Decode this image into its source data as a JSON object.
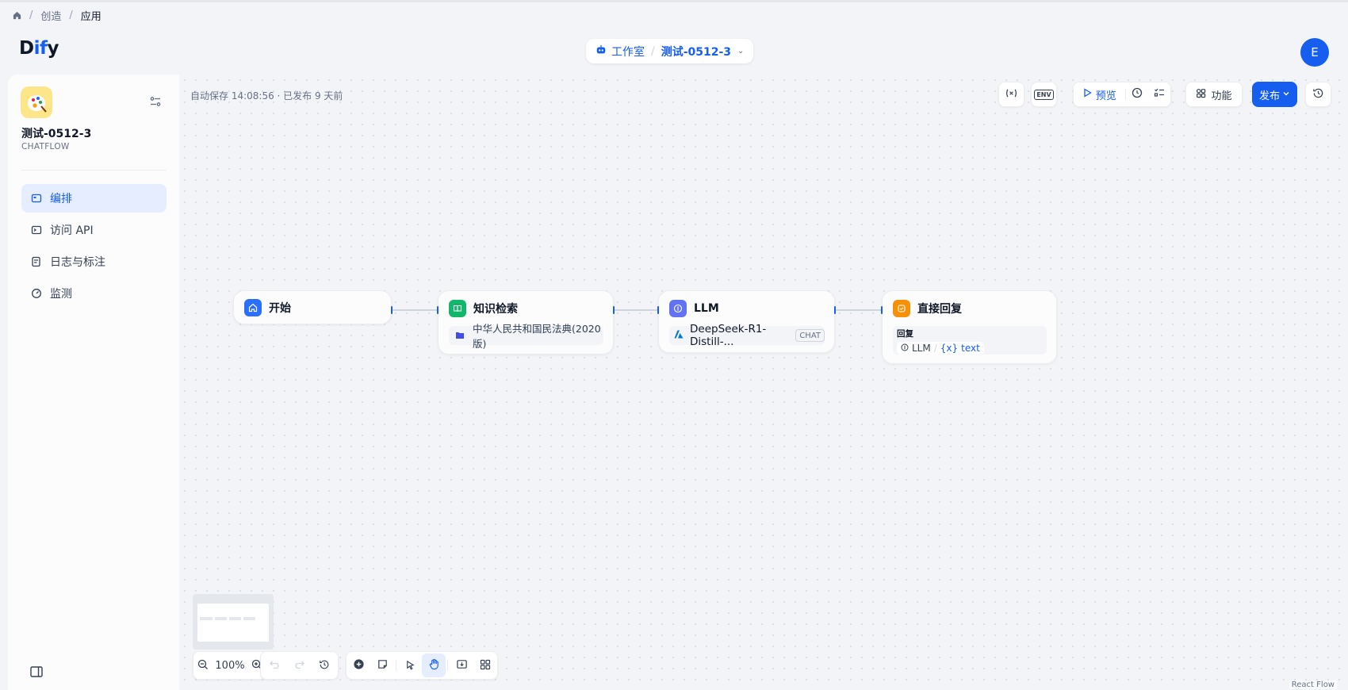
{
  "breadcrumb": {
    "items": [
      "创造",
      "应用"
    ]
  },
  "header": {
    "logo_prefix": "D",
    "logo_highlight": "if",
    "logo_suffix": "y",
    "workspace": "工作室",
    "app_name": "测试-0512-3",
    "avatar_initial": "E"
  },
  "sidebar": {
    "app_name": "测试-0512-3",
    "app_type": "CHATFLOW",
    "items": [
      {
        "label": "编排",
        "icon": "layout-icon",
        "active": true
      },
      {
        "label": "访问 API",
        "icon": "terminal-icon",
        "active": false
      },
      {
        "label": "日志与标注",
        "icon": "log-icon",
        "active": false
      },
      {
        "label": "监测",
        "icon": "monitor-icon",
        "active": false
      }
    ]
  },
  "canvas": {
    "autosave_text": "自动保存 14:08:56 · 已发布 9 天前",
    "toolbar": {
      "env_label": "ENV",
      "preview_label": "预览",
      "features_label": "功能",
      "publish_label": "发布"
    },
    "nodes": {
      "start": {
        "title": "开始"
      },
      "knowledge": {
        "title": "知识检索",
        "dataset": "中华人民共和国民法典(2020版)"
      },
      "llm": {
        "title": "LLM",
        "model": "DeepSeek-R1-Distill-...",
        "mode": "CHAT"
      },
      "answer": {
        "title": "直接回复",
        "label": "回复",
        "var_node": "LLM",
        "var_name": "text"
      }
    },
    "zoom": "100%",
    "attribution": "React Flow"
  },
  "colors": {
    "accent": "#155eef",
    "start_icon": "#2970ff",
    "knowledge_icon": "#12b76a",
    "llm_icon": "#6172f3",
    "answer_icon": "#f79009"
  }
}
